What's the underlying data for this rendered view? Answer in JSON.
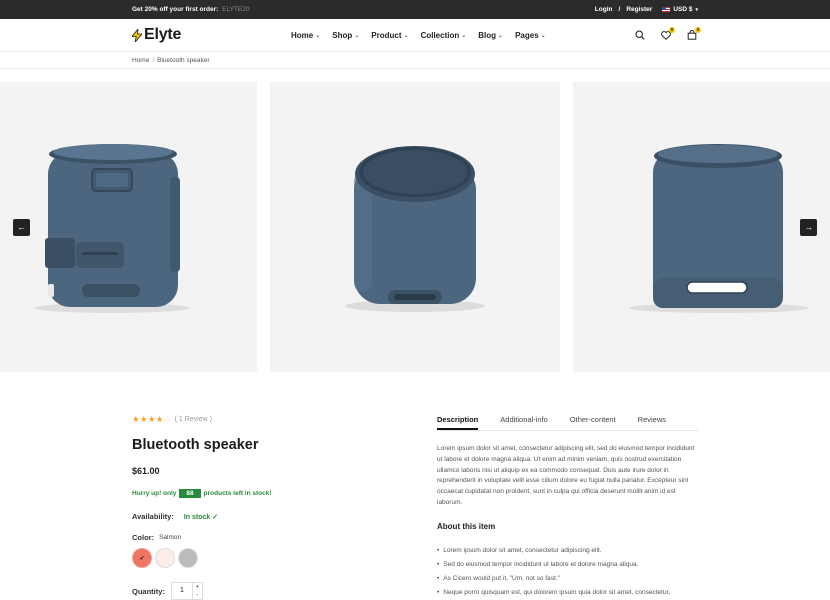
{
  "topbar": {
    "promo": "Get 20% off your first order:",
    "promo_code": "ELYTE20",
    "login": "Login",
    "sep": "/",
    "register": "Register",
    "currency": "USD $"
  },
  "header": {
    "logo_text": "Elyte",
    "nav": [
      {
        "label": "Home"
      },
      {
        "label": "Shop"
      },
      {
        "label": "Product"
      },
      {
        "label": "Collection"
      },
      {
        "label": "Blog"
      },
      {
        "label": "Pages"
      }
    ],
    "wishlist_count": "0",
    "cart_count": "0"
  },
  "breadcrumb": {
    "home": "Home",
    "sep": "/",
    "current": "Bluetooth speaker"
  },
  "gallery": {
    "prev_icon": "arrow-left-icon",
    "next_icon": "arrow-right-icon",
    "prev_glyph": "←",
    "next_glyph": "→",
    "speaker_color": "#4c6680"
  },
  "product": {
    "rating_value": 4,
    "rating_max": 5,
    "review_text": "( 1 Review )",
    "title": "Bluetooth speaker",
    "price": "$61.00",
    "hurry_prefix": "Hurry up! only",
    "stock_count": "88",
    "hurry_suffix": "products left in stock!",
    "availability_label": "Availability:",
    "availability_value": "In stock",
    "color_label": "Color:",
    "color_value": "Salmon",
    "swatches": [
      {
        "name": "Salmon",
        "color": "#f07563"
      },
      {
        "name": "Cream",
        "color": "#fbeee9"
      },
      {
        "name": "Gray",
        "color": "#bcbcbc"
      }
    ],
    "quantity_label": "Quantity:",
    "quantity_value": "1"
  },
  "tabs": {
    "items": [
      {
        "label": "Description"
      },
      {
        "label": "Additional-info"
      },
      {
        "label": "Other-content"
      },
      {
        "label": "Reviews"
      }
    ],
    "active_index": 0
  },
  "description": {
    "text": "Lorem ipsum dolor sit amet, consectetur adipiscing elit, sed do eiusmod tempor incididunt ut labore et dolore magna aliqua. Ut enim ad minim veniam, quis nostrud exercitation ullamco laboris nisi ut aliquip ex ea commodo consequat. Duis aute irure dolor in reprehenderit in voluptate velit esse cillum dolore eu fugiat nulla pariatur. Excepteur sint occaecat cupidatat non proident, sunt in culpa qui officia deserunt mollit anim id est laborum.",
    "about_title": "About this item",
    "bullets": [
      "Lorem ipsum dolor sit amet, consectetur adipiscing elit.",
      "Sed do eiusmod tempor incididunt ut labore et dolore magna aliqua.",
      "As Cicero would put it, \"Um, not so fast.\"",
      "Neque porro quisquam est, qui dolorem ipsum quia dolor sit amet, consectetur,"
    ]
  },
  "colors": {
    "accent": "#f5c400",
    "stock_green": "#2a8a3c",
    "dark": "#2b2b2b"
  }
}
